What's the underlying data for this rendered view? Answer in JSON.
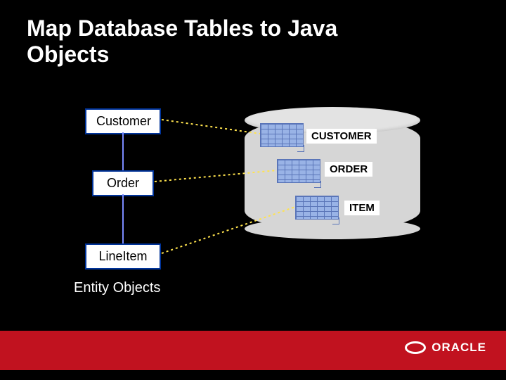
{
  "title_line1": "Map Database Tables to Java",
  "title_line2": "Objects",
  "entities": {
    "customer": "Customer",
    "order": "Order",
    "lineitem": "LineItem"
  },
  "caption": "Entity Objects",
  "tables": {
    "customer": "CUSTOMER",
    "order": "ORDER",
    "item": "ITEM"
  },
  "brand": "ORACLE",
  "colors": {
    "background": "#000000",
    "entity_border": "#003399",
    "footer": "#c1121f",
    "dot": "#ffe34d"
  }
}
